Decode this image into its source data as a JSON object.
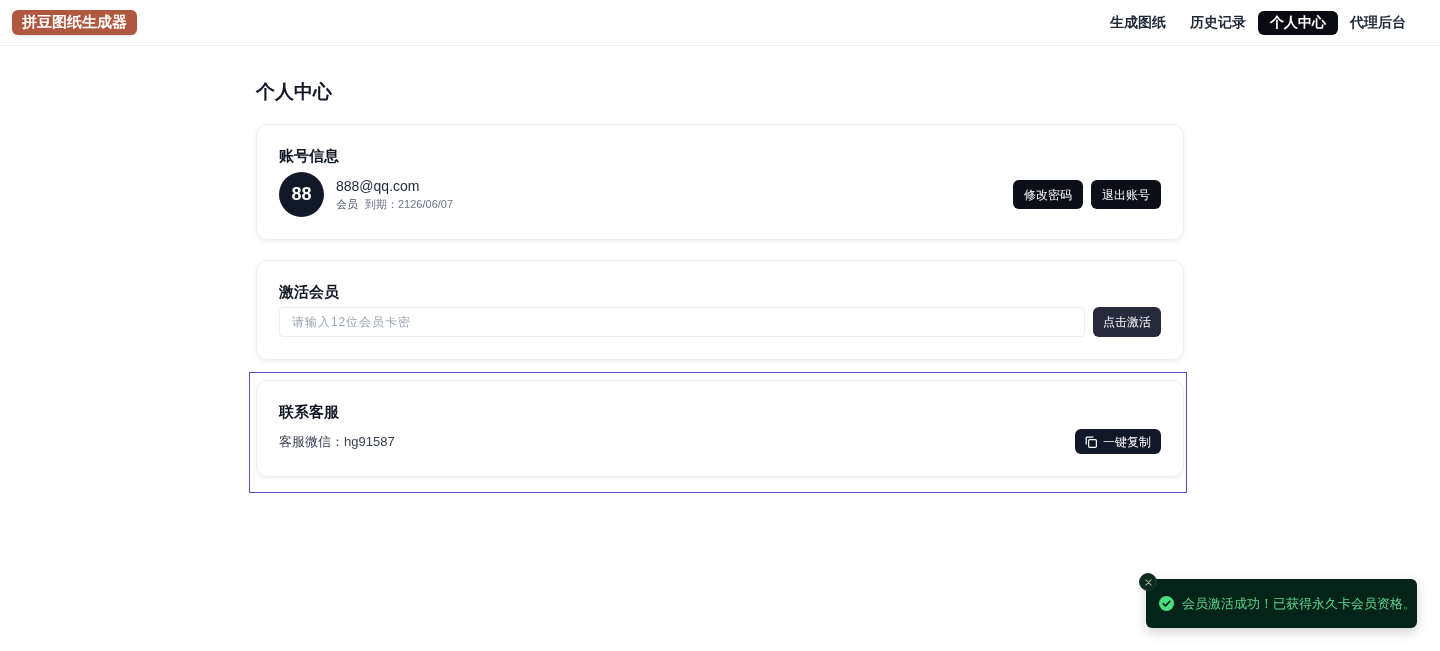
{
  "header": {
    "logo": "拼豆图纸生成器",
    "nav": [
      {
        "label": "生成图纸",
        "selected": false
      },
      {
        "label": "历史记录",
        "selected": false
      },
      {
        "label": "个人中心",
        "selected": true
      },
      {
        "label": "代理后台",
        "selected": false
      }
    ]
  },
  "page_title": "个人中心",
  "account": {
    "title": "账号信息",
    "avatar": "88",
    "email": "888@qq.com",
    "membership": "会员",
    "expiry": "到期：2126/06/07",
    "buttons": [
      "修改密码",
      "退出账号"
    ]
  },
  "activate": {
    "title": "激活会员",
    "input": {
      "placeholder": "请输入12位会员卡密"
    },
    "button": "点击激活"
  },
  "contact": {
    "title": "联系客服",
    "focused": true,
    "wechat": "客服微信：hg91587",
    "button": "一键复制"
  },
  "toast": {
    "message": "会员激活成功！已获得永久卡会员资格。"
  }
}
